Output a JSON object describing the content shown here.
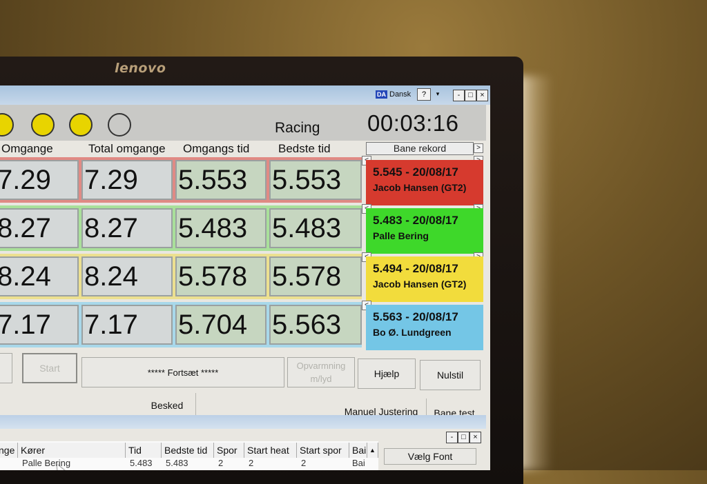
{
  "monitor": {
    "brand": "lenovo"
  },
  "window": {
    "language_flag": "DA",
    "language_label": "Dansk",
    "help_icon": "?",
    "dropdown_icon": "chevron-down-icon",
    "min_icon": "-",
    "max_icon": "□",
    "close_icon": "×"
  },
  "status": {
    "text": "Racing",
    "timer": "00:03:16"
  },
  "lights": [
    "yellow",
    "yellow",
    "yellow",
    "off"
  ],
  "headers": {
    "laps": "Omgange",
    "total_laps": "Total omgange",
    "lap_time": "Omgangs tid",
    "best_time": "Bedste tid",
    "track_record": "Bane rekord"
  },
  "lanes": [
    {
      "laps": "7.29",
      "total_laps": "7.29",
      "lap_time": "5.553",
      "best_time": "5.553",
      "record_time": "5.545 - 20/08/17",
      "record_holder": "Jacob Hansen (GT2)",
      "color": "#d63a2e",
      "band": "#e08a84"
    },
    {
      "laps": "8.27",
      "total_laps": "8.27",
      "lap_time": "5.483",
      "best_time": "5.483",
      "record_time": "5.483 - 20/08/17",
      "record_holder": "Palle Bering",
      "color": "#3ed82a",
      "band": "#a9e09a"
    },
    {
      "laps": "8.24",
      "total_laps": "8.24",
      "lap_time": "5.578",
      "best_time": "5.578",
      "record_time": "5.494 - 20/08/17",
      "record_holder": "Jacob Hansen (GT2)",
      "color": "#f2dc3c",
      "band": "#ece090"
    },
    {
      "laps": "7.17",
      "total_laps": "7.17",
      "lap_time": "5.704",
      "best_time": "5.563",
      "record_time": "5.563 - 20/08/17",
      "record_holder": "Bo Ø. Lundgreen",
      "color": "#74c6e6",
      "band": "#a8d8ea"
    }
  ],
  "buttons": {
    "start": "Start",
    "continue": "***** Fortsæt *****",
    "warmup_line1": "Opvarmning",
    "warmup_line2": "m/lyd",
    "help": "Hjælp",
    "reset": "Nulstil",
    "message": "Besked",
    "manual_adjust": "Manuel Justering",
    "track_test": "Bane test",
    "choose_font": "Vælg Font"
  },
  "table": {
    "columns": [
      "nge",
      "Kører",
      "Tid",
      "Bedste tid",
      "Spor",
      "Start heat",
      "Start spor",
      "Bai"
    ],
    "rows": [
      [
        "",
        "Palle Bering",
        "5.483",
        "5.483",
        "2",
        "2",
        "2",
        "Bai"
      ]
    ]
  }
}
